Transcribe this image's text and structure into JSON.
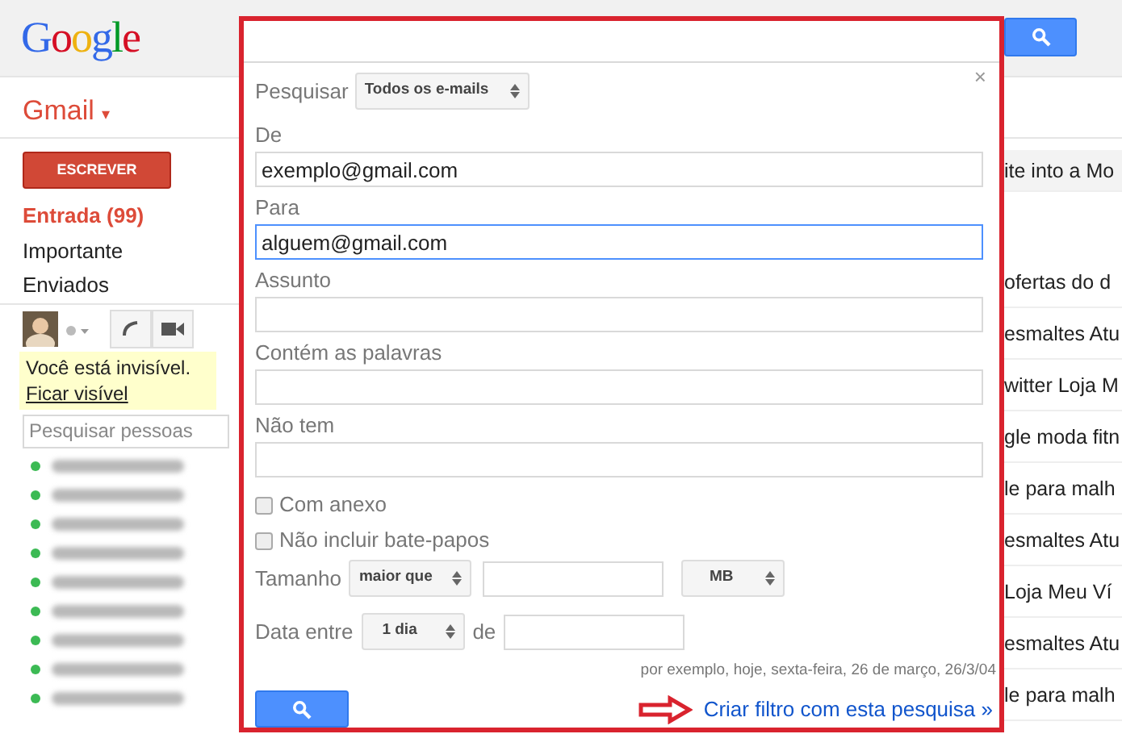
{
  "header": {
    "logo": "Google",
    "search_button": {
      "kind": "search"
    }
  },
  "app_menu": {
    "label": "Gmail",
    "caret": "▾"
  },
  "compose_button": "ESCREVER",
  "folders": [
    {
      "label": "Entrada (99)",
      "selected": true
    },
    {
      "label": "Importante",
      "selected": false
    },
    {
      "label": "Enviados",
      "selected": false
    }
  ],
  "chat": {
    "status_text": "Você está invisível.",
    "status_link": "Ficar visível",
    "search": {
      "placeholder": "Pesquisar pessoas"
    },
    "contacts": [
      {
        "color": "#3cba54"
      },
      {
        "color": "#3cba54"
      },
      {
        "color": "#3cba54"
      },
      {
        "color": "#3cba54"
      },
      {
        "color": "#3cba54"
      },
      {
        "color": "#3cba54"
      },
      {
        "color": "#3cba54"
      },
      {
        "color": "#3cba54"
      },
      {
        "color": "#3cba54"
      }
    ]
  },
  "messages": [
    {
      "snippet": "ite into a Mo",
      "selected": true
    },
    {
      "snippet": "ofertas do d",
      "selected": false
    },
    {
      "snippet": "esmaltes Atu",
      "selected": false
    },
    {
      "snippet": "witter Loja M",
      "selected": false
    },
    {
      "snippet": "gle moda fitn",
      "selected": false
    },
    {
      "snippet": "le para malh",
      "selected": false
    },
    {
      "snippet": "esmaltes Atu",
      "selected": false
    },
    {
      "snippet": "Loja Meu Ví",
      "selected": false
    },
    {
      "snippet": "esmaltes Atu",
      "selected": false
    },
    {
      "snippet": "le para malh",
      "selected": false
    }
  ],
  "search_panel": {
    "close": "×",
    "scope": {
      "label": "Pesquisar",
      "value": "Todos os e-mails"
    },
    "fields": [
      {
        "label": "De",
        "value": "exemplo@gmail.com",
        "focused": false
      },
      {
        "label": "Para",
        "value": "alguem@gmail.com",
        "focused": true
      },
      {
        "label": "Assunto",
        "focused": false
      },
      {
        "label": "Contém as palavras",
        "focused": false
      },
      {
        "label": "Não tem",
        "focused": false
      }
    ],
    "checkboxes": [
      {
        "label": "Com anexo",
        "checked": false
      },
      {
        "label": "Não incluir bate-papos",
        "checked": false
      }
    ],
    "size": {
      "label": "Tamanho",
      "comparison": "maior que",
      "unit": "MB"
    },
    "date": {
      "label": "Data entre",
      "range": "1 dia",
      "between": "de",
      "hint": "por exemplo, hoje, sexta-feira, 26 de março, 26/3/04"
    },
    "create_filter_link": "Criar filtro com esta pesquisa »"
  }
}
